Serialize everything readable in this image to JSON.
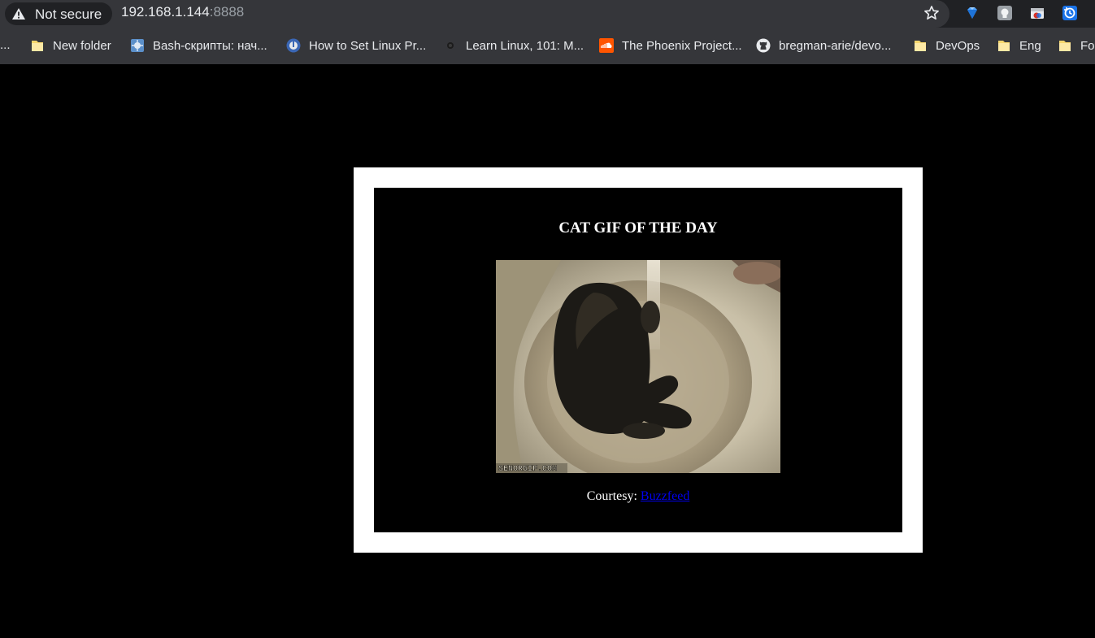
{
  "browser": {
    "security_label": "Not secure",
    "url_host": "192.168.1.144",
    "url_port": ":8888",
    "extensions": [
      "gem-icon",
      "extension-square-icon",
      "cast-window-icon",
      "history-sync-icon"
    ]
  },
  "bookmarks": {
    "overflow_label": "...",
    "items": [
      {
        "label": "New folder",
        "icon": "folder-icon"
      },
      {
        "label": "Bash-скрипты: нач...",
        "icon": "puzzle-site-icon"
      },
      {
        "label": "How to Set Linux Pr...",
        "icon": "blue-circle-site-icon"
      },
      {
        "label": "Learn Linux, 101: M...",
        "icon": "dark-site-icon"
      },
      {
        "label": "The Phoenix Project...",
        "icon": "soundcloud-icon"
      },
      {
        "label": "bregman-arie/devo...",
        "icon": "github-icon"
      },
      {
        "label": "DevOps",
        "icon": "folder-icon"
      },
      {
        "label": "Eng",
        "icon": "folder-icon"
      },
      {
        "label": "Fo",
        "icon": "folder-icon"
      }
    ]
  },
  "page": {
    "title": "CAT GIF OF THE DAY",
    "gif_watermark": "SENORGIF.COM",
    "courtesy_prefix": "Courtesy: ",
    "courtesy_link": "Buzzfeed"
  },
  "colors": {
    "page_background": "#000000",
    "frame": "#ffffff",
    "link": "#0000ee",
    "folder": "#f6d66d"
  }
}
